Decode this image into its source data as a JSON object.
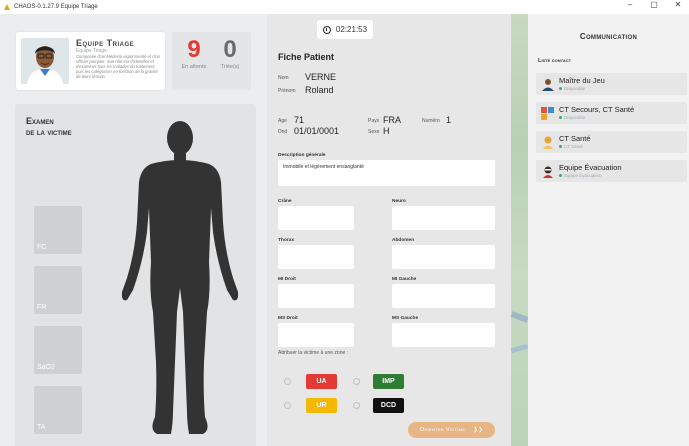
{
  "window": {
    "title": "CHAOS-0.1.27.9 Equipe Triage",
    "controls": [
      "–",
      "▢",
      "✕"
    ]
  },
  "team": {
    "name": "Equipe Triage",
    "subtitle": "Equipe Triage",
    "description": "Composée d'un Médecin expérimenté et d'un officier pompier. Son rôle est d'identifier et d'examiner tous les malades du traitement, puis les catégoriser en fonction de la gravité de leurs lésions."
  },
  "counters": {
    "waiting_value": "9",
    "waiting_label": "En attente",
    "sorted_value": "0",
    "sorted_label": "Triée(s)"
  },
  "exam": {
    "title_line1": "Examen",
    "title_line2": "de la victime",
    "vitals": [
      "FC",
      "FR",
      "SaO2",
      "TA"
    ]
  },
  "timer": {
    "value": "02:21:53"
  },
  "patient": {
    "title": "Fiche Patient",
    "nom_label": "Nom",
    "nom_value": "VERNE",
    "prenom_label": "Prénom",
    "prenom_value": "Roland",
    "age_label": "Age",
    "age_value": "71",
    "pays_label": "Pays",
    "pays_value": "FRA",
    "numero_label": "Numéro",
    "numero_value": "1",
    "ddn_label": "Dnd",
    "ddn_value": "01/01/0001",
    "sexe_label": "Sexe",
    "sexe_value": "H",
    "desc_label": "Description générale",
    "desc_value": "Immobile et légèrement ensanglanté",
    "fields": {
      "crane": "Crâne",
      "neuro": "Neuro",
      "thorax": "Thorax",
      "abdomen": "Abdomen",
      "mi_droit": "MI Droit",
      "mi_gauche": "MI Gauche",
      "ms_droit": "MS Droit",
      "ms_gauche": "MS Gauche"
    },
    "zone_label": "Attribuer la victime à une zone :",
    "categories": {
      "ua": "UA",
      "ur": "UR",
      "imp": "IMP",
      "dcd": "DCD"
    },
    "category_colors": {
      "ua": "#e53935",
      "ur": "#f5b800",
      "imp": "#2e7d32",
      "dcd": "#111111"
    },
    "orient_label": "Orienter Victime",
    "orient_arrow": "❯❯"
  },
  "comm": {
    "title": "Communication",
    "contacts_title": "Liste contact",
    "contacts": [
      {
        "name": "Maître du Jeu",
        "status": "Disponible",
        "icon": "game-master-icon"
      },
      {
        "name": "CT Secours, CT Santé",
        "status": "Disponible",
        "icon": "group-icon"
      },
      {
        "name": "CT Santé",
        "status": "CT Santé",
        "icon": "health-icon"
      },
      {
        "name": "Equipe Évacuation",
        "status": "Equipe Évacuation",
        "icon": "evacuation-icon"
      }
    ]
  }
}
